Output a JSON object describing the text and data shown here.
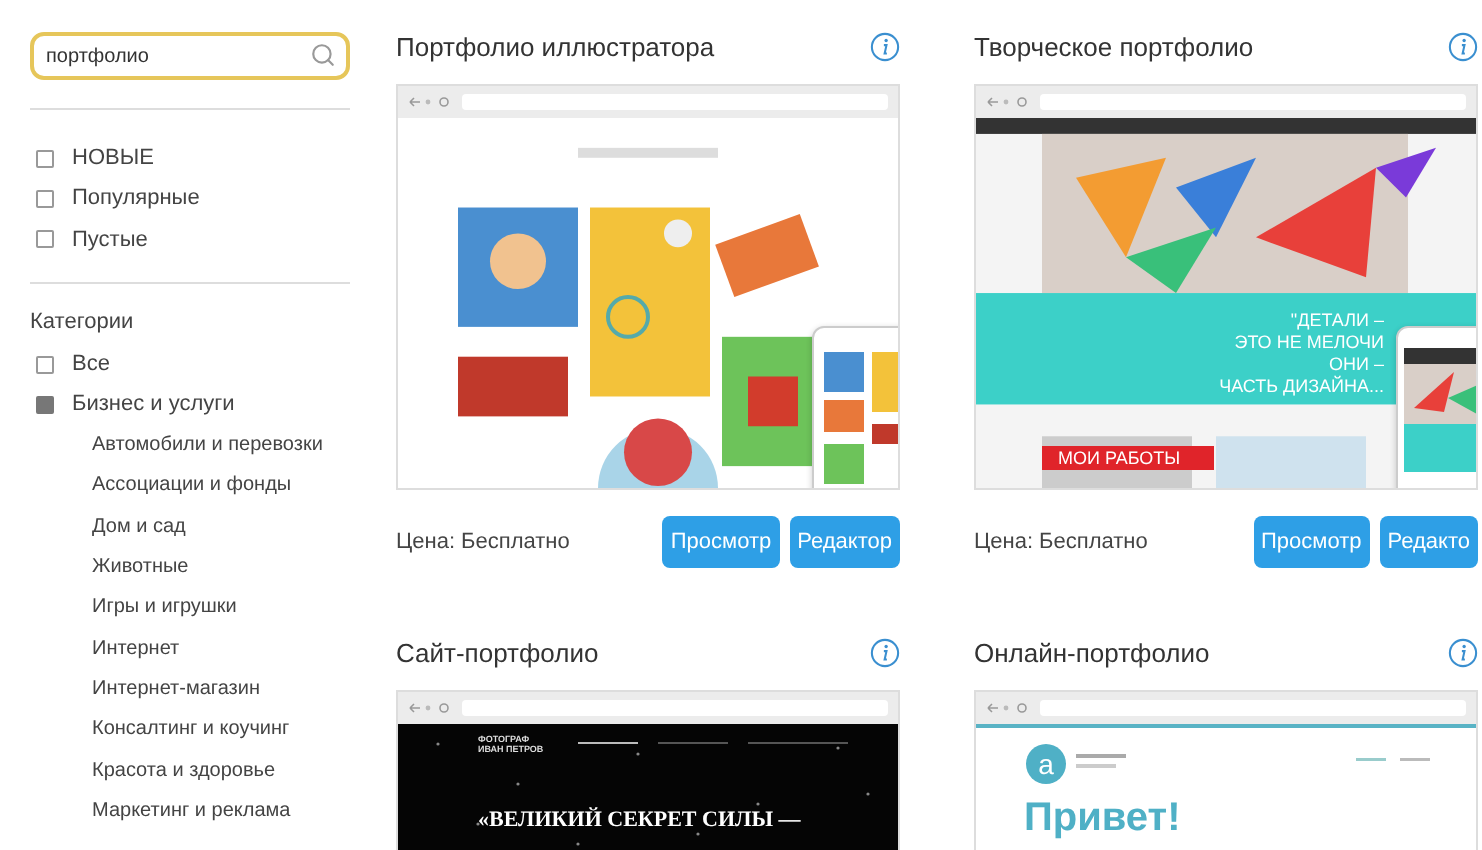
{
  "search": {
    "value": "портфолио"
  },
  "filters": [
    {
      "label": "НОВЫЕ",
      "checked": false
    },
    {
      "label": "Популярные",
      "checked": false
    },
    {
      "label": "Пустые",
      "checked": false
    }
  ],
  "categories": {
    "title": "Категории",
    "items": [
      {
        "label": "Все",
        "checked": false
      },
      {
        "label": "Бизнес и услуги",
        "checked": true,
        "children": [
          {
            "label": "Автомобили и перевозки"
          },
          {
            "label": "Ассоциации и фонды"
          },
          {
            "label": "Дом и сад"
          },
          {
            "label": "Животные"
          },
          {
            "label": "Игры и игрушки"
          },
          {
            "label": "Интернет"
          },
          {
            "label": "Интернет-магазин"
          },
          {
            "label": "Консалтинг и коучинг"
          },
          {
            "label": "Красота и здоровье"
          },
          {
            "label": "Маркетинг и реклама"
          }
        ]
      }
    ]
  },
  "templates": [
    {
      "title": "Портфолио иллюстратора",
      "price": "Цена: Бесплатно",
      "buttons": [
        "Просмотр",
        "Редактор"
      ],
      "preview": {
        "kind": "illustrations"
      }
    },
    {
      "title": "Творческое портфолио",
      "price": "Цена: Бесплатно",
      "buttons": [
        "Просмотр",
        "Редакто"
      ],
      "preview": {
        "kind": "origami",
        "quote": [
          "\"ДЕТАЛИ –",
          "ЭТО НЕ МЕЛОЧИ",
          "ОНИ –",
          "ЧАСТЬ ДИЗАЙНА..."
        ],
        "section": "МОИ РАБОТЫ"
      }
    },
    {
      "title": "Сайт-портфолио",
      "preview": {
        "kind": "photographer",
        "brand": [
          "ФОТОГРАФ",
          "ИВАН ПЕТРОВ"
        ],
        "quote": "«ВЕЛИКИЙ СЕКРЕТ СИЛЫ —"
      }
    },
    {
      "title": "Онлайн-портфолио",
      "preview": {
        "kind": "blog",
        "avatar": "a",
        "greeting": "Привет!"
      }
    }
  ]
}
